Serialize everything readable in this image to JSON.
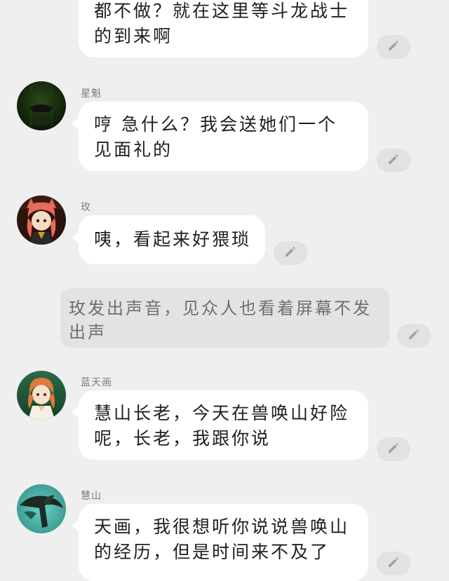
{
  "colors": {
    "background": "#efefef",
    "bubble": "#ffffff",
    "narration_bubble": "#e3e3e3",
    "edit_button": "#e2e2e2",
    "name_text": "#7a7a7a"
  },
  "messages": [
    {
      "type": "dialogue",
      "speaker": "",
      "text": "都不做？就在这里等斗龙战士的到来啊",
      "edit_icon": "pencil-icon"
    },
    {
      "type": "dialogue",
      "speaker": "星魁",
      "text": "哼 急什么？我会送她们一个见面礼的",
      "edit_icon": "pencil-icon"
    },
    {
      "type": "dialogue",
      "speaker": "玫",
      "text": "咦，看起来好猥琐",
      "edit_icon": "pencil-icon"
    },
    {
      "type": "narration",
      "speaker": "",
      "text": "玫发出声音，见众人也看着屏幕不发出声",
      "edit_icon": "pencil-icon"
    },
    {
      "type": "dialogue",
      "speaker": "蓝天画",
      "text": "慧山长老，今天在兽唤山好险呢，长老，我跟你说",
      "edit_icon": "pencil-icon"
    },
    {
      "type": "dialogue",
      "speaker": "慧山",
      "text": "天画，我很想听你说说兽唤山的经历，但是时间来不及了",
      "edit_icon": "pencil-icon"
    }
  ]
}
